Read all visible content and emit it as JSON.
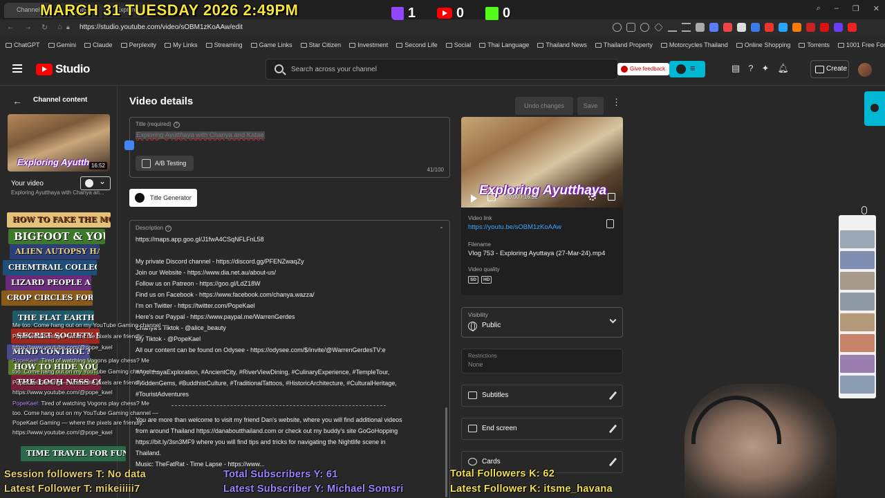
{
  "overlay": {
    "date_time": "MARCH 31 TUESDAY 2026 2:49PM",
    "twitch_count": "1",
    "youtube_count": "0",
    "kick_count": "0",
    "session_followers": "Session followers T: No data",
    "latest_follower_t": "Latest Follower T: mikeiiiii7",
    "total_subscribers": "Total Subscribers Y: 61",
    "latest_subscriber": "Latest Subscriber Y: Michael Somsri",
    "total_followers_k": "Total Followers K: 62",
    "latest_follower_k": "Latest Follower K: itsme_havana",
    "books": [
      "HOW TO FAKE THE MOON LANDING",
      "BIGFOOT & YOU",
      "ALIEN AUTOPSY HANDBOOK",
      "CHEMTRAIL COLLECTION GUIDE",
      "LIZARD PEOPLE AMONG US",
      "CROP CIRCLES FOR DUMMIES",
      "THE FLAT EARTH PRIMER",
      "SECRET SOCIETY ETIQUETTE",
      "MIND CONTROL MADE EASY",
      "HOW TO HIDE YOUR BUNKER",
      "THE LOCH NESS CONSPIRACY",
      "TIME TRAVEL FOR FUN & PROFIT"
    ],
    "chat": [
      {
        "name": "",
        "text": "Me too. Come hang out on my YouTube Gaming channel —"
      },
      {
        "name": "",
        "text": "PopeKael Gaming — where the pixels are friendly:"
      },
      {
        "name": "",
        "text": "https://www.youtube.com/@pope_kael"
      },
      {
        "name": "PopeKael:",
        "text": "Tired of watching Vogons play chess? Me"
      },
      {
        "name": "",
        "text": "too. Come hang out on my YouTube Gaming channel —"
      },
      {
        "name": "",
        "text": "PopeKael Gaming — where the pixels are friendly:"
      },
      {
        "name": "",
        "text": "https://www.youtube.com/@pope_kael"
      },
      {
        "name": "PopeKael:",
        "text": "Tired of watching Vogons play chess? Me"
      },
      {
        "name": "",
        "text": "too. Come hang out on my YouTube Gaming channel —"
      },
      {
        "name": "",
        "text": "PopeKael Gaming — where the pixels are friendly:"
      },
      {
        "name": "",
        "text": "https://www.youtube.com/@pope_kael"
      }
    ]
  },
  "browser": {
    "tabs": [
      "Channel",
      "Chanel",
      "Explore"
    ],
    "url": "https://studio.youtube.com/video/sOBM1zKoAAw/edit",
    "bookmarks": [
      "ChatGPT",
      "Gemini",
      "Claude",
      "Perplexity",
      "My Links",
      "Streaming",
      "Game Links",
      "Star Citizen",
      "Investment",
      "Second Life",
      "Social",
      "Thai Language",
      "Thailand News",
      "Thailand Property",
      "Motorcycles Thailand",
      "Online Shopping",
      "Torrents",
      "1001 Free Fonts",
      "Background Remover"
    ]
  },
  "header": {
    "logo_text": "Studio",
    "search_placeholder": "Search across your channel",
    "feedback_label": "Give feedback",
    "create_label": "Create"
  },
  "sidebar": {
    "section_title": "Channel content",
    "thumb_title": "Exploring Ayutth",
    "thumb_duration": "16:52",
    "your_video_label": "Your video",
    "video_subtitle": "Exploring Ayutthaya with Chanya an..."
  },
  "details": {
    "page_title": "Video details",
    "undo_label": "Undo changes",
    "save_label": "Save",
    "title_label": "Title (required)",
    "title_value": "Exploring Ayutthaya with Chanya and Katae",
    "ab_label": "A/B Testing",
    "char_count": "41/100",
    "title_generator_label": "Title Generator",
    "description_label": "Description",
    "description_lines": [
      "https://maps.app.goo.gl/J1fwA4CSqNFLFnL58",
      "",
      "My private Discord channel - https://discord.gg/PFENZwaqZy",
      "Join our Website - https://www.dia.net.au/about-us/",
      "Follow us on Patreon - https://goo.gl/LdZ18W",
      "Find us on Facebook - https://www.facebook.com/chanya.wazza/",
      "I'm on Twitter - https://twitter.com/PopeKael",
      "Here's our Paypal - https://www.paypal.me/WarrenGerdes",
      "Chanya's Tiktok - @alice_beauty",
      "My Tiktok - @PopeKael",
      "All our content can be found on Odysee - https://odysee.com/$/invite/@WarrenGerdesTV:e",
      "",
      "#AyutthayaExploration, #AncientCity, #RiverViewDining, #CulinaryExperience, #TempleTour,",
      "#HiddenGems, #BuddhistCulture, #TraditionalTattoos, #HistoricArchitecture, #CulturalHeritage,",
      "#TouristAdventures"
    ],
    "description_lines_2": [
      "You are more than welcome to visit my friend Dan's website, where you will find additional videos",
      "from around Thailand https://danaboutthailand.com or check out my buddy's site GoGoHopping",
      "https://bit.ly/3sn3MF9 where you will find tips and tricks for navigating the Nightlife scene in",
      "Thailand.",
      "Music: TheFatRat - Time Lapse - https://www..."
    ]
  },
  "video": {
    "player_title": "Exploring Ayutthaya",
    "time": "00:00 / 16:52",
    "link_label": "Video link",
    "link": "https://youtu.be/sOBM1zKoAAw",
    "filename_label": "Filename",
    "filename": "Vlog 753 - Exploring Ayuttaya (27-Mar-24).mp4",
    "quality_label": "Video quality",
    "quality_badges": [
      "SD",
      "HD"
    ]
  },
  "visibility": {
    "label": "Visibility",
    "value": "Public"
  },
  "restrictions": {
    "label": "Restrictions",
    "value": "None"
  },
  "options": [
    "Subtitles",
    "End screen",
    "Cards"
  ]
}
